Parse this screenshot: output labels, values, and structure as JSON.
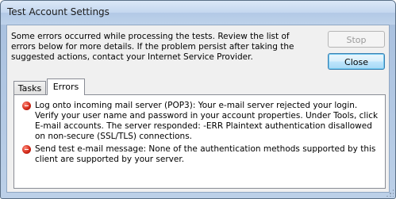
{
  "window": {
    "title": "Test Account Settings"
  },
  "message": {
    "text": "Some errors occurred while processing the tests. Review the list of errors below for more details. If the problem persist after taking the suggested actions, contact your Internet Service Provider."
  },
  "buttons": {
    "stop_label": "Stop",
    "close_label": "Close"
  },
  "tabs": [
    {
      "label": "Tasks",
      "selected": false
    },
    {
      "label": "Errors",
      "selected": true
    }
  ],
  "errors": [
    {
      "icon": "error-icon",
      "text": "Log onto incoming mail server (POP3): Your e-mail server rejected your login. Verify your user name and password in your account properties. Under Tools, click E-mail accounts. The server responded: -ERR Plaintext authentication disallowed on non-secure (SSL/TLS) connections."
    },
    {
      "icon": "error-icon",
      "text": "Send test e-mail message: None of the authentication methods supported by this client are supported by your server."
    }
  ],
  "colors": {
    "title_bar": "#c4d7ef",
    "dialog_background": "#f0f0f0",
    "error_icon": "#d42a1a",
    "default_button_border": "#3c7fb1"
  }
}
